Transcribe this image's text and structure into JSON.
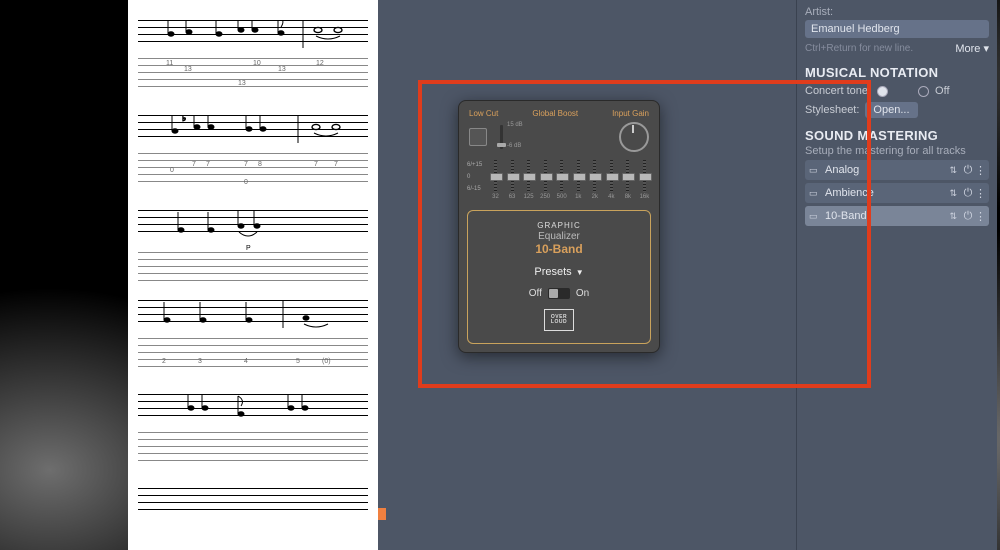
{
  "sidebar": {
    "artist_label": "Artist:",
    "artist_value": "Emanuel Hedberg",
    "newline_hint": "Ctrl+Return for new line.",
    "more_label": "More ▾",
    "notation_heading": "MUSICAL NOTATION",
    "concert_tone_label": "Concert tone:",
    "concert_tone_off": "Off",
    "stylesheet_label": "Stylesheet:",
    "open_label": "Open...",
    "mastering_heading": "SOUND MASTERING",
    "mastering_sub": "Setup the mastering for all tracks",
    "rows": [
      {
        "name": "Analog",
        "selected": false
      },
      {
        "name": "Ambience",
        "selected": false
      },
      {
        "name": "10-Band",
        "selected": true
      }
    ]
  },
  "eq": {
    "low_cut": "Low Cut",
    "global_boost": "Global Boost",
    "boost_max": "15 dB",
    "boost_min": "-6 dB",
    "input_gain": "Input Gain",
    "scale_top": "6/+15",
    "scale_mid": "0",
    "scale_bot": "6/-15",
    "freqs": [
      "32",
      "63",
      "125",
      "250",
      "500",
      "1k",
      "2k",
      "4k",
      "8k",
      "16k"
    ],
    "graphic": "GRAPHIC",
    "equalizer": "Equalizer",
    "name": "10-Band",
    "presets": "Presets",
    "off": "Off",
    "on": "On",
    "brand1": "OVER",
    "brand2": "LOUD"
  },
  "tab_values": {
    "sys1": [
      "11",
      "13",
      "13",
      "10",
      "13",
      "12"
    ],
    "sys2": [
      "0",
      "7",
      "7",
      "7",
      "0",
      "8",
      "7",
      "7"
    ],
    "sys3": [
      "2",
      "3",
      "4",
      "5",
      "(0)"
    ]
  }
}
